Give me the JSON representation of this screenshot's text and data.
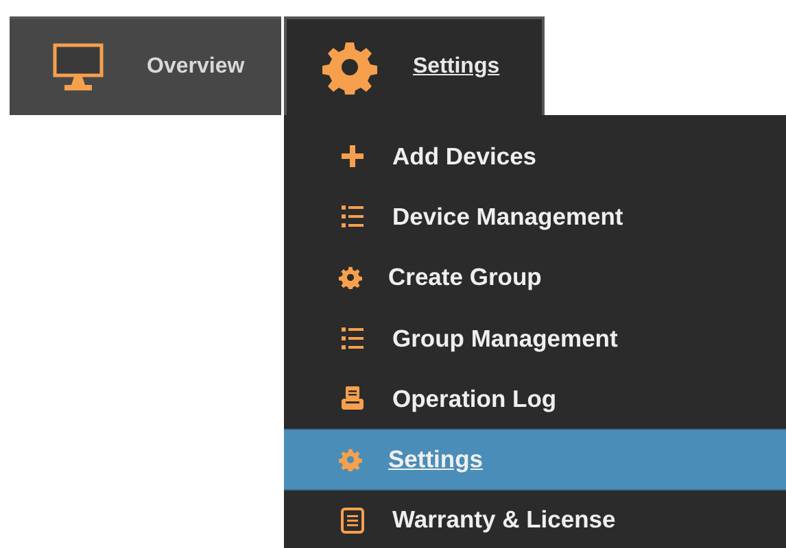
{
  "tabs": [
    {
      "label": "Overview",
      "kind": "monitor",
      "selected": false
    },
    {
      "label": "Settings",
      "kind": "gear",
      "selected": true
    }
  ],
  "menu": {
    "items": [
      {
        "label": "Add Devices",
        "kind": "plus",
        "selected": false
      },
      {
        "label": "Device Management",
        "kind": "list",
        "selected": false
      },
      {
        "label": "Create Group",
        "kind": "gear",
        "selected": false
      },
      {
        "label": "Group Management",
        "kind": "list",
        "selected": false
      },
      {
        "label": "Operation Log",
        "kind": "printer",
        "selected": false
      },
      {
        "label": "Settings",
        "kind": "gear",
        "selected": true
      },
      {
        "label": "Warranty & License",
        "kind": "document",
        "selected": false
      }
    ]
  }
}
